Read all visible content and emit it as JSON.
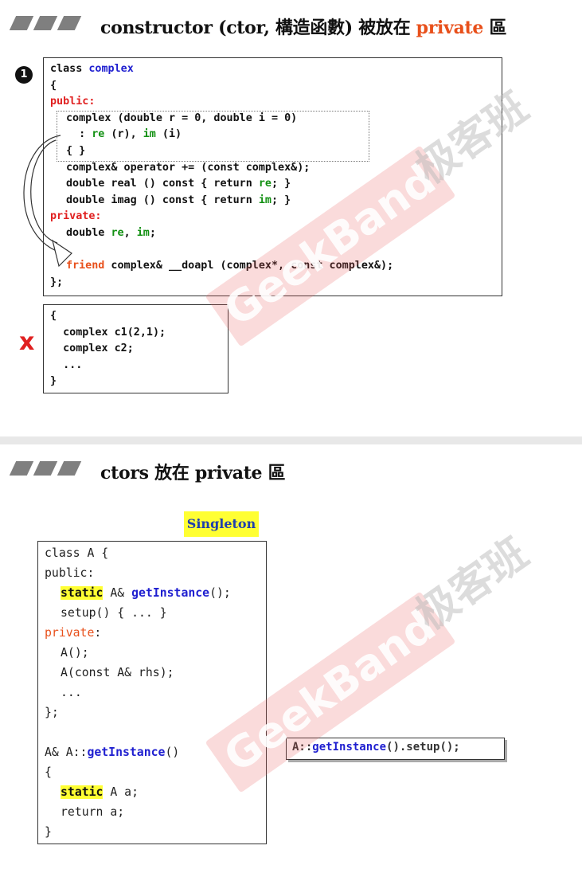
{
  "slide1": {
    "title_pre": "constructor (ctor, 構造函數) 被放在 ",
    "title_hl": "private",
    "title_post": " 區",
    "badge": "1",
    "code": {
      "l1a": "class ",
      "l1b": "complex",
      "l2": "{",
      "l3": "public:",
      "l4": "complex (double r = 0, double i = 0)",
      "l5a": "  : ",
      "l5b": "re",
      "l5c": " (r), ",
      "l5d": "im",
      "l5e": " (i)",
      "l6": "{ }",
      "l7": "complex& operator += (const complex&);",
      "l8a": "double real () const { return ",
      "l8b": "re",
      "l8c": "; }",
      "l9a": "double imag () const { return ",
      "l9b": "im",
      "l9c": "; }",
      "l10": "private:",
      "l11a": "double ",
      "l11b": "re",
      "l11c": ", ",
      "l11d": "im",
      "l11e": ";",
      "l12a": "friend",
      "l12b": " complex& __doapl (complex*, const complex&);",
      "l13": "};"
    },
    "usage": {
      "l1": "{",
      "l2": "  complex c1(2,1);",
      "l3": "  complex c2;",
      "l4": "  ...",
      "l5": "}"
    },
    "x_mark": "x"
  },
  "slide2": {
    "title": "ctors 放在 private 區",
    "singleton": "Singleton",
    "code": {
      "l1": "class A {",
      "l2": "public:",
      "l3a": "static",
      "l3b": " A& ",
      "l3c": "getInstance",
      "l3d": "();",
      "l4": "setup() { ... }",
      "l5": "private",
      "l5b": ":",
      "l6": "A();",
      "l7": "A(const A& rhs);",
      "l8": "...",
      "l9": "};",
      "l10a": "A& A::",
      "l10b": "getInstance",
      "l10c": "()",
      "l11": "{",
      "l12a": "static",
      "l12b": " A a;",
      "l13": "return a;",
      "l14": "}"
    },
    "call": {
      "a": "A::",
      "b": "getInstance",
      "c": "().setup();"
    }
  },
  "watermark": {
    "brand": "GeekBand",
    "cn": "极客班"
  }
}
